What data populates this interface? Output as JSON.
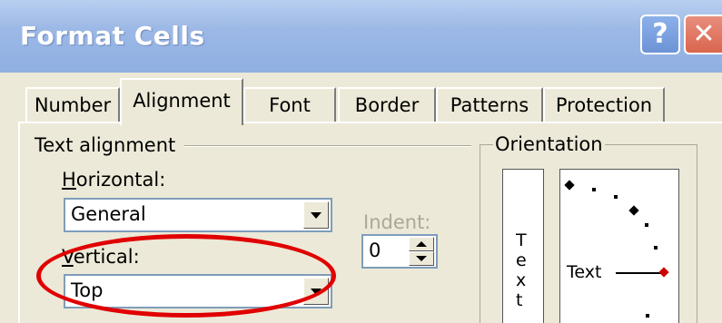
{
  "window": {
    "title": "Format Cells",
    "help_glyph": "?",
    "close_glyph": "✕"
  },
  "tabs": [
    {
      "label": "Number",
      "active": false
    },
    {
      "label": "Alignment",
      "active": true
    },
    {
      "label": "Font",
      "active": false
    },
    {
      "label": "Border",
      "active": false
    },
    {
      "label": "Patterns",
      "active": false
    },
    {
      "label": "Protection",
      "active": false
    }
  ],
  "text_alignment": {
    "group_label": "Text alignment",
    "horizontal": {
      "label_accel": "H",
      "label_rest": "orizontal:",
      "value": "General"
    },
    "vertical": {
      "label_accel": "V",
      "label_rest": "ertical:",
      "value": "Top"
    },
    "indent": {
      "label": "Indent:",
      "value": "0"
    }
  },
  "orientation": {
    "group_label": "Orientation",
    "vertical_letters": [
      "T",
      "e",
      "x",
      "t"
    ],
    "dial_label": "Text"
  },
  "annotation": {
    "ellipse_color": "#e00000"
  },
  "colors": {
    "title_bar": "#9cb8e6",
    "dialog_bg": "#ece9d8",
    "close_button": "#d9664e"
  }
}
